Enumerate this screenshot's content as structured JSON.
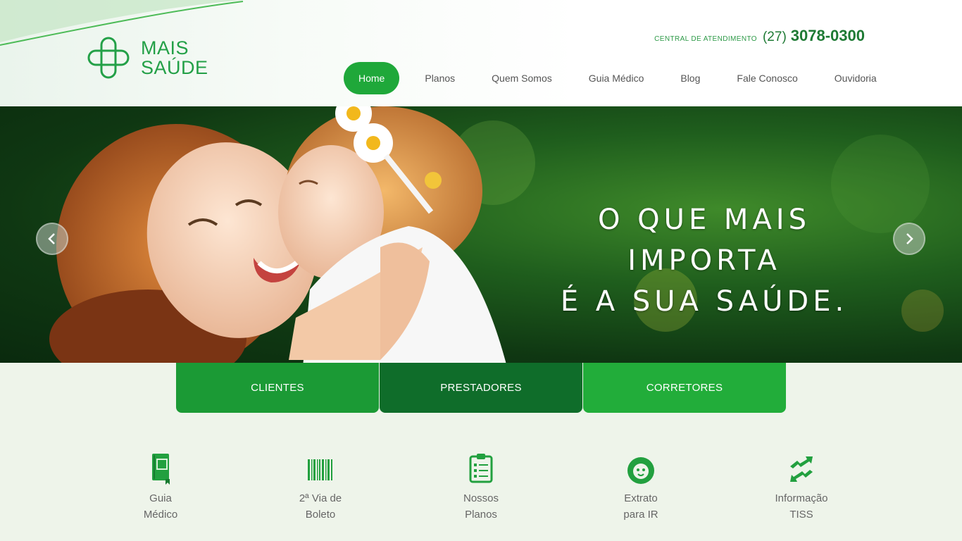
{
  "brand": {
    "line1": "MAIS",
    "line2": "SAÚDE"
  },
  "contact": {
    "label": "CENTRAL DE ATENDIMENTO",
    "ddd": "(27)",
    "number": "3078-0300"
  },
  "nav": {
    "items": [
      {
        "label": "Home",
        "active": true
      },
      {
        "label": "Planos"
      },
      {
        "label": "Quem Somos"
      },
      {
        "label": "Guia Médico"
      },
      {
        "label": "Blog"
      },
      {
        "label": "Fale Conosco"
      },
      {
        "label": "Ouvidoria"
      }
    ]
  },
  "hero": {
    "line1": "O QUE MAIS IMPORTA",
    "line2": "É A SUA SAÚDE.",
    "prev_icon": "chevron-left-icon",
    "next_icon": "chevron-right-icon"
  },
  "tabs": [
    {
      "label": "CLIENTES"
    },
    {
      "label": "PRESTADORES"
    },
    {
      "label": "CORRETORES"
    }
  ],
  "quick_links": [
    {
      "line1": "Guia",
      "line2": "Médico",
      "icon": "book-icon"
    },
    {
      "line1": "2ª Via de",
      "line2": "Boleto",
      "icon": "barcode-icon"
    },
    {
      "line1": "Nossos",
      "line2": "Planos",
      "icon": "clipboard-icon"
    },
    {
      "line1": "Extrato",
      "line2": "para IR",
      "icon": "lion-icon"
    },
    {
      "line1": "Informação",
      "line2": "TISS",
      "icon": "exchange-icon"
    }
  ],
  "colors": {
    "brand_green": "#23a047",
    "nav_active": "#1fa83a",
    "tab_dark": "#0f6d2a"
  }
}
